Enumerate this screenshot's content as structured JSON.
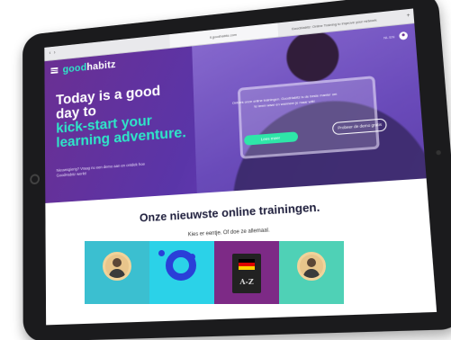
{
  "browser": {
    "tabs": [
      {
        "label": "",
        "active": false
      },
      {
        "label": "lt.goodhabitz.com",
        "active": true
      },
      {
        "label": "GoodHabitz: Online Training to improve your network",
        "active": false
      }
    ]
  },
  "site": {
    "logo_prefix": "good",
    "logo_suffix": "habitz",
    "header_right_text": "NL EN",
    "menu_icon": "hamburger-icon",
    "user_icon": "user-icon"
  },
  "hero": {
    "headline_white": "Today is a good day to",
    "headline_accent": "kick-start your learning adventure.",
    "subtext": "Nieuwsgierig? Vraag nu een demo aan en ontdek hoe GoodHabitz werkt!",
    "photo_text": "Ontdek onze online trainingen. GoodHabitz is de beste manier om te leren waar en wanneer je maar wilt!",
    "primary_button": "Lees meer",
    "secondary_button": "Probeer de demo gratis"
  },
  "section": {
    "title": "Onze nieuwste online trainingen.",
    "subtitle": "Kies er eentje. Of doe ze allemaal."
  },
  "cards": [
    {
      "name": "trainer-portrait-card",
      "color": "#3bbfd0",
      "icon": "avatar-icon"
    },
    {
      "name": "ring-graphic-card",
      "color": "#2bd2e8",
      "icon": "ring-icon"
    },
    {
      "name": "german-dictionary-card",
      "color": "#7d2a86",
      "icon": "book-icon",
      "book_text": "A-Z"
    },
    {
      "name": "presenter-portrait-card",
      "color": "#4fd1b6",
      "icon": "avatar-icon"
    }
  ],
  "colors": {
    "accent": "#2ee6c8",
    "hero_purple": "#6a2f93",
    "button_green": "#2ee6a8",
    "heading_dark": "#1d1d3b"
  }
}
